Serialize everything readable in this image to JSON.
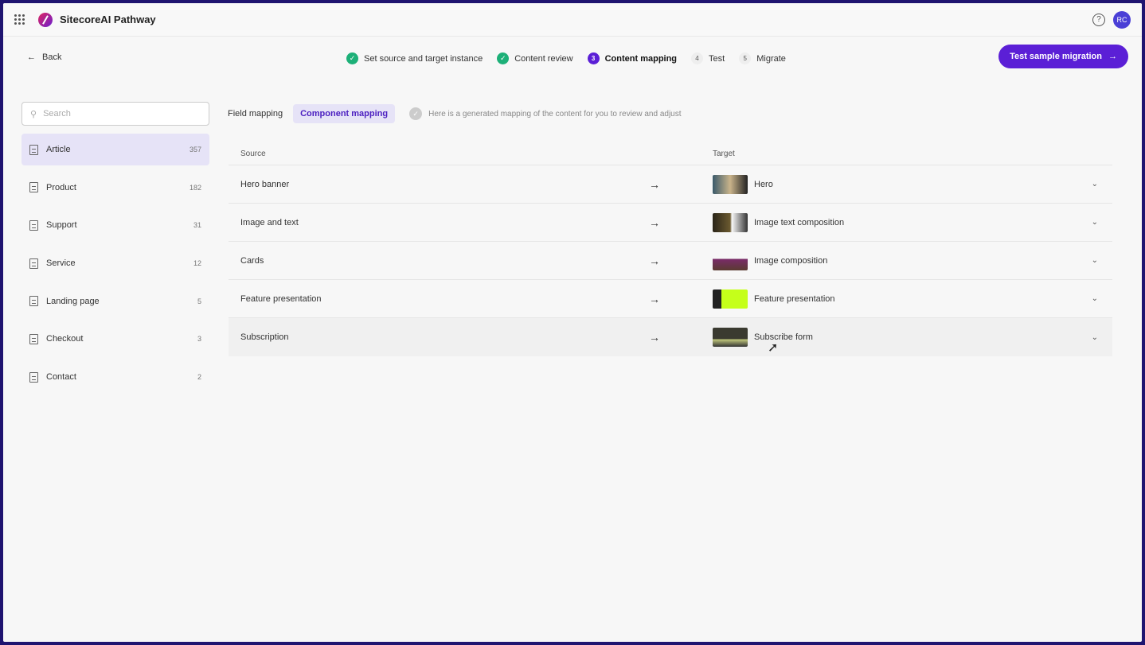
{
  "app": {
    "title": "SitecoreAI Pathway",
    "avatar": "RC",
    "help": "?"
  },
  "nav": {
    "back": "Back",
    "cta": "Test sample migration",
    "steps": [
      {
        "n": "1",
        "label": "Set source and target instance",
        "state": "done"
      },
      {
        "n": "2",
        "label": "Content review",
        "state": "done"
      },
      {
        "n": "3",
        "label": "Content mapping",
        "state": "active"
      },
      {
        "n": "4",
        "label": "Test",
        "state": "todo"
      },
      {
        "n": "5",
        "label": "Migrate",
        "state": "todo"
      }
    ]
  },
  "sidebar": {
    "search_placeholder": "Search",
    "items": [
      {
        "label": "Article",
        "count": "357"
      },
      {
        "label": "Product",
        "count": "182"
      },
      {
        "label": "Support",
        "count": "31"
      },
      {
        "label": "Service",
        "count": "12"
      },
      {
        "label": "Landing page",
        "count": "5"
      },
      {
        "label": "Checkout",
        "count": "3"
      },
      {
        "label": "Contact",
        "count": "2"
      }
    ]
  },
  "tabs": {
    "field": "Field mapping",
    "component": "Component mapping",
    "hint": "Here is a generated mapping of the content for you to review and adjust"
  },
  "table": {
    "source_header": "Source",
    "target_header": "Target",
    "rows": [
      {
        "source": "Hero banner",
        "target": "Hero",
        "thumb": "linear-gradient(90deg,#3a5a6a,#c9b38a 50%,#222)"
      },
      {
        "source": "Image and text",
        "target": "Image text composition",
        "thumb": "linear-gradient(90deg,#2a2418,#6b5a30 50%,#f7f7f7 55%,#333)"
      },
      {
        "source": "Cards",
        "target": "Image composition",
        "thumb": "linear-gradient(180deg,#f7f7f7 40%,#7a2b6a 40%,#5a3a30)"
      },
      {
        "source": "Feature presentation",
        "target": "Feature presentation",
        "thumb": "linear-gradient(90deg,#222 25%,#c5ff1a 25%)"
      },
      {
        "source": "Subscription",
        "target": "Subscribe form",
        "thumb": "linear-gradient(180deg,#3a3a30 60%,#c8d080 60%,#333)"
      }
    ]
  },
  "colors": {
    "accent": "#5b1fd6",
    "done": "#1db078"
  }
}
